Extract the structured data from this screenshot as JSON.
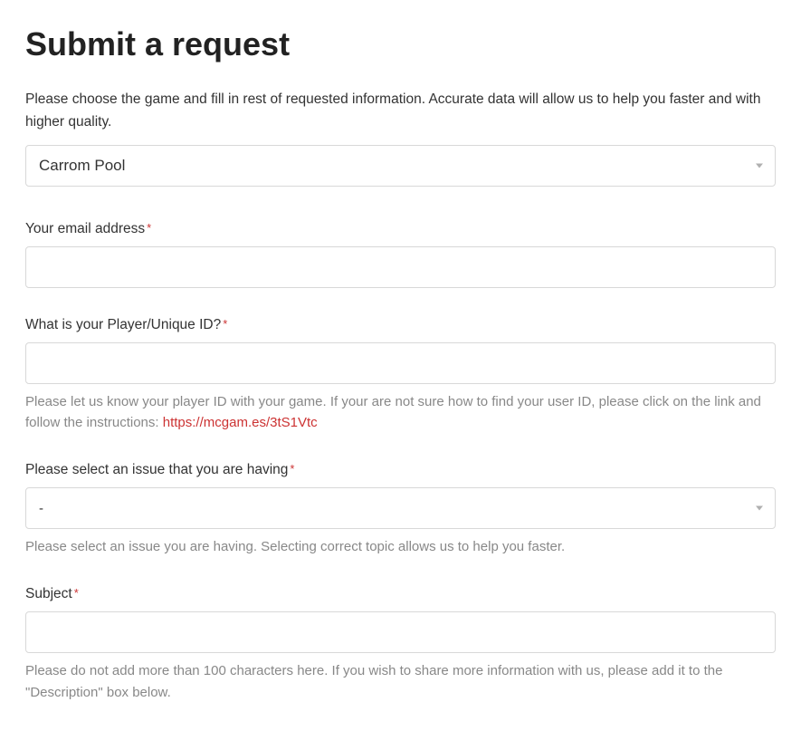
{
  "title": "Submit a request",
  "intro": "Please choose the game and fill in rest of requested information. Accurate data will allow us to help you faster and with higher quality.",
  "game_select": {
    "selected": "Carrom Pool"
  },
  "email": {
    "label": "Your email address",
    "value": ""
  },
  "player_id": {
    "label": "What is your Player/Unique ID?",
    "value": "",
    "helper_prefix": "Please let us know your player ID with your game. If your are not sure how to find your user ID, please click on the link and follow the instructions: ",
    "helper_link_text": "https://mcgam.es/3tS1Vtc"
  },
  "issue": {
    "label": "Please select an issue that you are having",
    "selected": "-",
    "helper": "Please select an issue you are having. Selecting correct topic allows us to help you faster."
  },
  "subject": {
    "label": "Subject",
    "value": "",
    "helper": "Please do not add more than 100 characters here. If you wish to share more information with us, please add it to the \"Description\" box below."
  },
  "required_marker": "*"
}
